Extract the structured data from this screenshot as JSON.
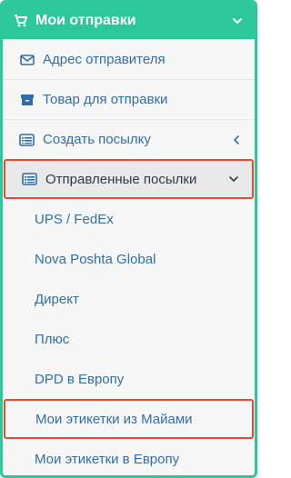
{
  "colors": {
    "accent": "#2cc79a",
    "link": "#2f6ea8",
    "highlight_border": "#e84a2e"
  },
  "menu": {
    "title": "Мои отправки",
    "title_icon": "cart-icon",
    "items": [
      {
        "label": "Адрес отправителя",
        "icon": "envelope-icon"
      },
      {
        "label": "Товар для отправки",
        "icon": "archive-box-icon"
      },
      {
        "label": "Создать посылку",
        "icon": "list-card-icon",
        "chevron": "chevron-left-icon"
      },
      {
        "label": "Отправленные посылки",
        "icon": "list-card-icon",
        "chevron": "chevron-down-icon"
      }
    ],
    "subitems": [
      {
        "label": "UPS / FedEx"
      },
      {
        "label": "Nova Poshta Global"
      },
      {
        "label": "Директ"
      },
      {
        "label": "Плюс"
      },
      {
        "label": "DPD в Европу"
      },
      {
        "label": "Мои этикетки из Майами"
      },
      {
        "label": "Мои этикетки в Европу"
      }
    ]
  }
}
